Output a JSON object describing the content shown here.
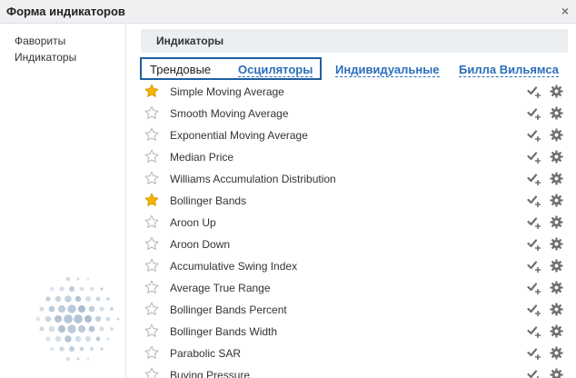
{
  "window": {
    "title": "Форма индикаторов",
    "close_glyph": "×"
  },
  "sidebar": {
    "items": [
      {
        "label": "Фавориты"
      },
      {
        "label": "Индикаторы"
      }
    ]
  },
  "section": {
    "title": "Индикаторы"
  },
  "tabs": [
    {
      "label": "Трендовые",
      "active": true
    },
    {
      "label": "Осциляторы",
      "active": false
    },
    {
      "label": "Индивидуальные",
      "active": false
    },
    {
      "label": "Билла Вильямса",
      "active": false
    }
  ],
  "indicators": [
    {
      "name": "Simple Moving Average",
      "favorite": true
    },
    {
      "name": "Smooth Moving Average",
      "favorite": false
    },
    {
      "name": "Exponential Moving Average",
      "favorite": false
    },
    {
      "name": "Median Price",
      "favorite": false
    },
    {
      "name": "Williams Accumulation Distribution",
      "favorite": false
    },
    {
      "name": "Bollinger Bands",
      "favorite": true
    },
    {
      "name": "Aroon Up",
      "favorite": false
    },
    {
      "name": "Aroon Down",
      "favorite": false
    },
    {
      "name": "Accumulative Swing Index",
      "favorite": false
    },
    {
      "name": "Average True Range",
      "favorite": false
    },
    {
      "name": "Bollinger Bands Percent",
      "favorite": false
    },
    {
      "name": "Bollinger Bands Width",
      "favorite": false
    },
    {
      "name": "Parabolic SAR",
      "favorite": false
    },
    {
      "name": "Buying Pressure",
      "favorite": false
    }
  ],
  "icons": {
    "favorite": "star-icon",
    "add": "checkmark-plus-icon",
    "settings": "gear-icon",
    "logo": "dotted-sphere-logo"
  },
  "colors": {
    "accent": "#2a6ebb",
    "tab_border": "#1f5f9e",
    "star_filled": "#f5b400",
    "star_empty": "#b5b5b5",
    "icon_gray": "#6f6f6f",
    "header_bg": "#eceff2"
  }
}
